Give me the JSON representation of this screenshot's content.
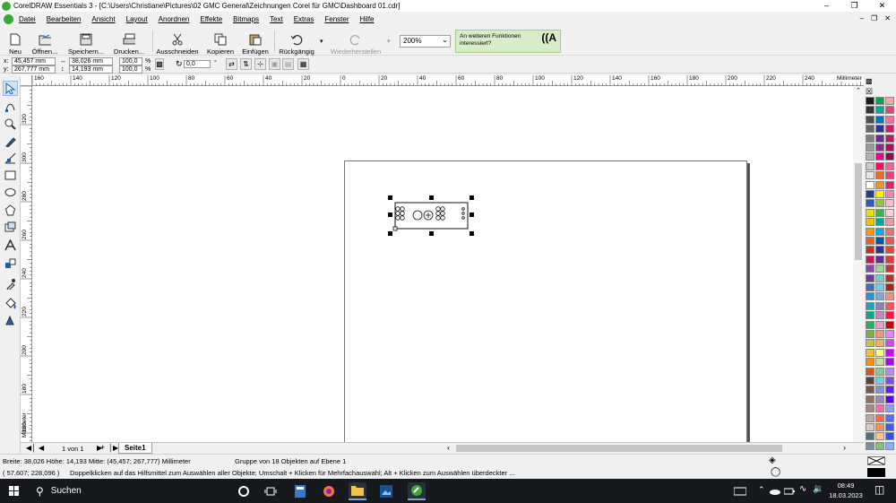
{
  "window": {
    "title": "CorelDRAW Essentials 3 - [C:\\Users\\Christiane\\Pictures\\02 GMC General\\Zeichnungen Corel für GMC\\Dashboard 01.cdr]"
  },
  "menu": [
    "Datei",
    "Bearbeiten",
    "Ansicht",
    "Layout",
    "Anordnen",
    "Effekte",
    "Bitmaps",
    "Text",
    "Extras",
    "Fenster",
    "Hilfe"
  ],
  "toolbar": {
    "new": "Neu",
    "open": "Öffnen...",
    "save": "Speichern...",
    "print": "Drucken...",
    "cut": "Ausschneiden",
    "copy": "Kopieren",
    "paste": "Einfügen",
    "undo": "Rückgängig",
    "redo": "Wiederherstellen",
    "zoom": "200%",
    "hint": "An weiteren Funktionen interessiert?"
  },
  "properties": {
    "x_label": "x:",
    "x": "45,457 mm",
    "y_label": "y:",
    "y": "267,777 mm",
    "w": "38,026 mm",
    "h": "14,193 mm",
    "scale_x": "100,0",
    "scale_y": "100,0",
    "pct": "%",
    "angle": "0,0",
    "deg": "°"
  },
  "ruler": {
    "unit": "Millimeter",
    "h_labels": [
      "160",
      "140",
      "120",
      "100",
      "80",
      "60",
      "40",
      "20",
      "0",
      "20",
      "40",
      "60",
      "80",
      "100",
      "120",
      "140",
      "160",
      "180",
      "200",
      "220",
      "240"
    ],
    "v_labels": [
      "320",
      "300",
      "280",
      "260",
      "240",
      "220",
      "200",
      "180",
      "160"
    ],
    "v_unit": "Millimeter"
  },
  "pages": {
    "count": "1 von 1",
    "tab": "Seite1"
  },
  "status": {
    "size": "Breite: 38,026  Höhe: 14,193  Mitte: (45,457; 267,777) Millimeter",
    "selection": "Gruppe von 18 Objekten auf Ebene 1",
    "coords": "( 57,607; 228,096 )",
    "help": "Doppelklicken auf das Hilfsmittel zum Auswählen aller Objekte; Umschalt + Klicken für Mehrfachauswahl; Alt + Klicken zum Auswählen überdeckter ..."
  },
  "taskbar": {
    "search": "Suchen",
    "time": "08:49",
    "date": "18.03.2023"
  },
  "colors": {
    "accent_green": "#3ea836",
    "taskbar": "#16191e"
  }
}
